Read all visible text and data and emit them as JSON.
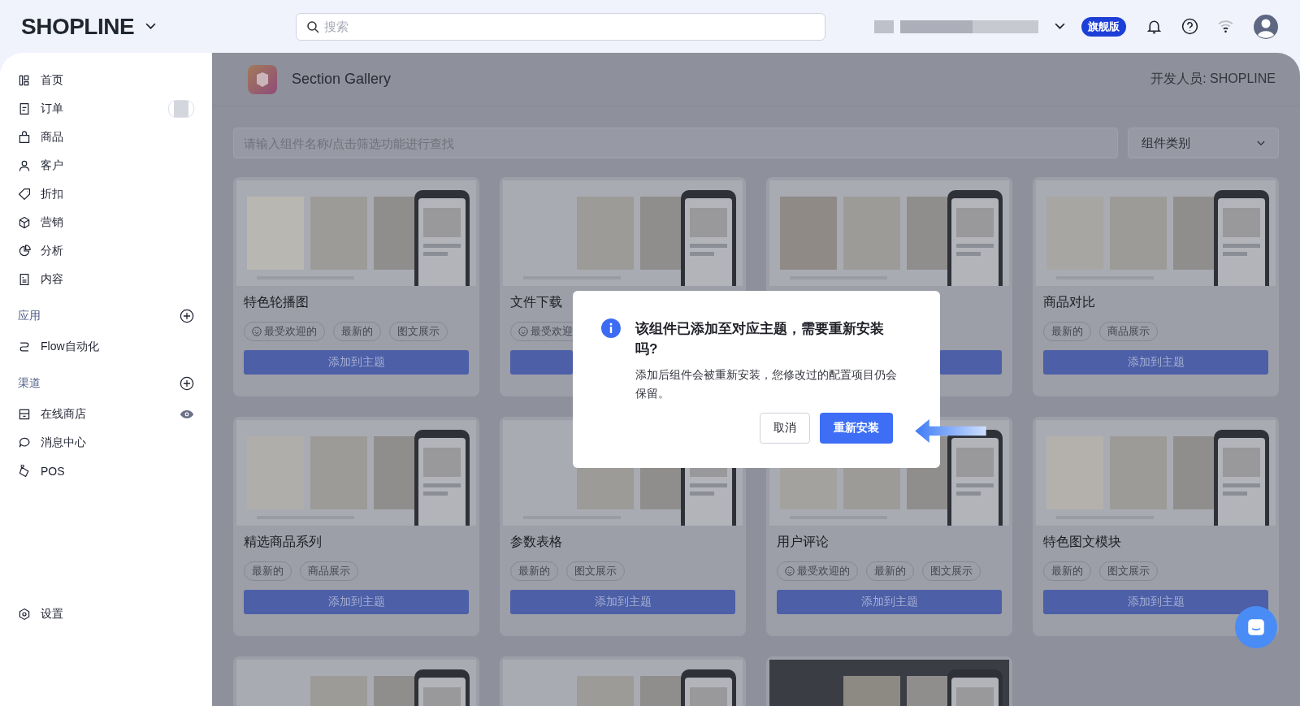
{
  "header": {
    "logo": "SHOPLINE",
    "search": {
      "placeholder": "搜索"
    },
    "plan_badge": "旗舰版"
  },
  "sidebar": {
    "nav": [
      "首页",
      "订单",
      "商品",
      "客户",
      "折扣",
      "营销",
      "分析",
      "内容"
    ],
    "sections": [
      {
        "title": "应用",
        "items": [
          "Flow自动化"
        ]
      },
      {
        "title": "渠道",
        "items": [
          "在线商店",
          "消息中心",
          "POS"
        ]
      }
    ],
    "footer": "设置"
  },
  "app": {
    "title": "Section Gallery",
    "developer": "开发人员: SHOPLINE"
  },
  "filter": {
    "placeholder": "请输入组件名称/点击筛选功能进行查找",
    "category": "组件类别"
  },
  "cards": [
    {
      "kind": "card",
      "title": "特色轮播图",
      "tags": [
        {
          "label": "最受欢迎的",
          "popular": true
        },
        {
          "label": "最新的",
          "popular": false
        },
        {
          "label": "图文展示",
          "popular": false
        }
      ],
      "button": "添加到主题"
    },
    {
      "kind": "card",
      "title": "文件下载",
      "tags": [
        {
          "label": "最受欢迎",
          "popular": true
        }
      ]
    },
    {
      "kind": "card"
    },
    {
      "kind": "card",
      "title": "商品对比",
      "tags": [
        {
          "label": "最新的",
          "popular": false
        },
        {
          "label": "商品展示",
          "popular": false
        }
      ],
      "button": "添加到主题"
    },
    {
      "kind": "card",
      "title": "精选商品系列",
      "tags": [
        {
          "label": "最新的",
          "popular": false
        },
        {
          "label": "商品展示",
          "popular": false
        }
      ],
      "button": "添加到主题"
    },
    {
      "kind": "card",
      "title": "参数表格",
      "tags": [
        {
          "label": "最新的",
          "popular": false
        },
        {
          "label": "图文展示",
          "popular": false
        }
      ],
      "button": "添加到主题"
    },
    {
      "kind": "card",
      "title": "用户评论",
      "tags": [
        {
          "label": "最受欢迎的",
          "popular": true
        },
        {
          "label": "最新的",
          "popular": false
        },
        {
          "label": "图文展示",
          "popular": false
        }
      ],
      "button": "添加到主题"
    },
    {
      "kind": "card",
      "title": "特色图文模块",
      "tags": [
        {
          "label": "最新的",
          "popular": false
        },
        {
          "label": "图文展示",
          "popular": false
        }
      ],
      "button": "添加到主题"
    },
    {
      "kind": "preview"
    },
    {
      "kind": "preview"
    },
    {
      "kind": "preview"
    }
  ],
  "dialog": {
    "title": "该组件已添加至对应主题，需要重新安装吗?",
    "message": "添加后组件会被重新安装，您修改过的配置项目仍会保留。",
    "cancel": "取消",
    "confirm": "重新安装"
  }
}
